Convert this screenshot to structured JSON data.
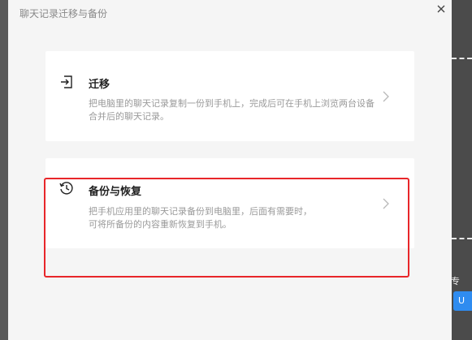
{
  "dialog": {
    "title": "聊天记录迁移与备份",
    "close_icon": "close-icon"
  },
  "cards": [
    {
      "icon": "import-arrow-icon",
      "title": "迁移",
      "description": "把电脑里的聊天记录复制一份到手机上，完成后可在手机上浏览两台设备合并后的聊天记录。",
      "chevron": "chevron-right-icon"
    },
    {
      "icon": "history-clock-icon",
      "title": "备份与恢复",
      "description_line1": "把手机应用里的聊天记录备份到电脑里，后面有需要时，",
      "description_line2": "可将所备份的内容重新恢复到手机。",
      "chevron": "chevron-right-icon"
    }
  ],
  "background": {
    "partial_text": "专",
    "partial_button": "U"
  },
  "colors": {
    "dialog_bg": "#f5f5f5",
    "card_bg": "#ffffff",
    "highlight_border": "#e8262a",
    "accent_button": "#2f8cf0"
  }
}
